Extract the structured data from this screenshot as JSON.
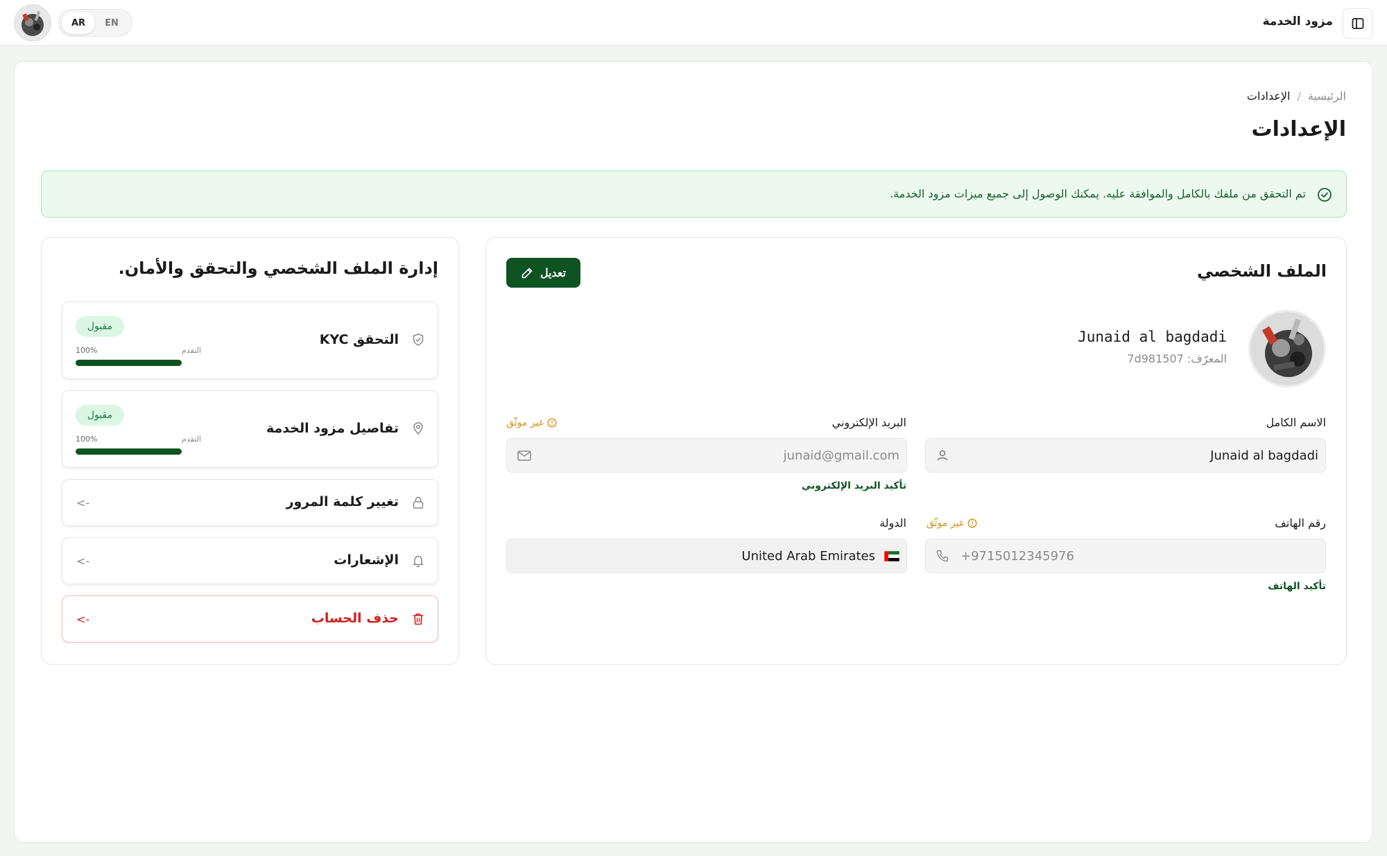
{
  "header": {
    "app_title": "مزود الخدمة",
    "languages": [
      {
        "code": "AR",
        "active": true
      },
      {
        "code": "EN",
        "active": false
      }
    ]
  },
  "breadcrumb": {
    "home": "الرئيسية",
    "separator": "/",
    "current": "الإعدادات"
  },
  "page": {
    "title": "الإعدادات"
  },
  "alert": {
    "text": "تم التحقق من ملفك بالكامل والموافقة عليه. يمكنك الوصول إلى جميع ميزات مزود الخدمة."
  },
  "profile": {
    "title": "الملف الشخصي",
    "edit_label": "تعديل",
    "name": "Junaid al bagdadi",
    "id_label": "المعرّف: 7d981507",
    "fields": {
      "full_name": {
        "label": "الاسم الكامل",
        "value": "Junaid al bagdadi"
      },
      "email": {
        "label": "البريد الإلكتروني",
        "value": "junaid@gmail.com",
        "status": "غير موثّق",
        "verify_link": "تأكيد البريد الإلكتروني"
      },
      "phone": {
        "label": "رقم الهاتف",
        "value": "+9715012345976",
        "status": "غير موثّق",
        "verify_link": "تأكيد الهاتف"
      },
      "country": {
        "label": "الدولة",
        "value": "United Arab Emirates"
      }
    }
  },
  "manage": {
    "title": "إدارة الملف الشخصي والتحقق والأمان.",
    "items": [
      {
        "label": "التحقق KYC",
        "badge": "مقبول",
        "progress_label": "التقدم",
        "progress_text": "100%",
        "progress": 1.0
      },
      {
        "label": "تفاصيل مزود الخدمة",
        "badge": "مقبول",
        "progress_label": "التقدم",
        "progress_text": "100%",
        "progress": 1.0
      },
      {
        "label": "تغيير كلمة المرور",
        "arrow": "<-"
      },
      {
        "label": "الإشعارات",
        "arrow": "<-"
      },
      {
        "label": "حذف الحساب",
        "arrow": "<-"
      }
    ]
  },
  "colors": {
    "brand": "#0f5323",
    "warning": "#d39113",
    "danger": "#d42020",
    "success_bg": "#ebf9ef"
  }
}
